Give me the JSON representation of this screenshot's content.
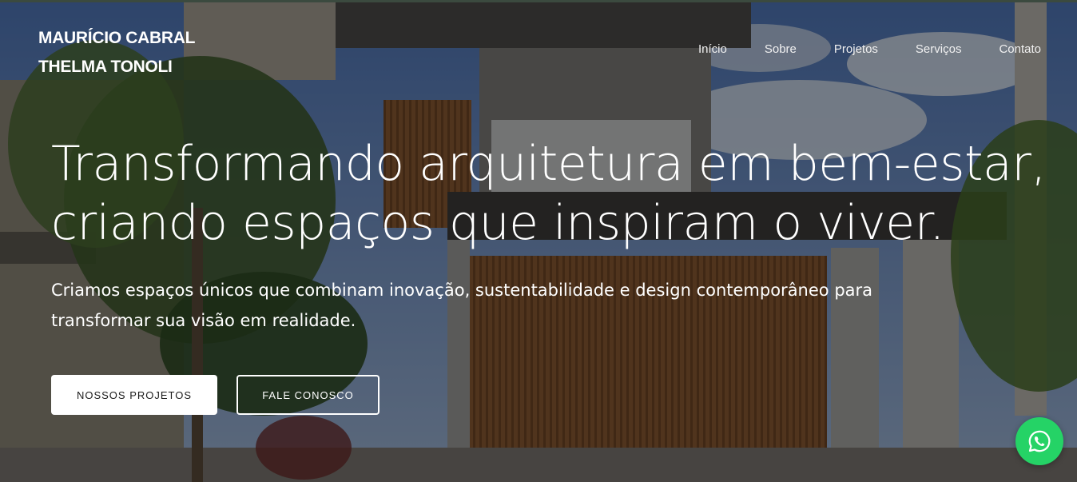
{
  "brand": {
    "line1": "MAURÍCIO CABRAL",
    "line2": "THELMA TONOLI"
  },
  "nav": {
    "items": [
      {
        "label": "Início"
      },
      {
        "label": "Sobre"
      },
      {
        "label": "Projetos"
      },
      {
        "label": "Serviços"
      },
      {
        "label": "Contato"
      }
    ]
  },
  "hero": {
    "headline_line1": "Transformando arquitetura em bem-estar,",
    "headline_line2": "criando espaços que inspiram o viver.",
    "subtitle_line1": "Criamos espaços únicos que combinam inovação, sustentabilidade e design contemporâneo para",
    "subtitle_line2": "transformar sua visão em realidade.",
    "primary_button": "NOSSOS PROJETOS",
    "secondary_button": "FALE CONOSCO"
  },
  "floating": {
    "whatsapp_icon": "whatsapp-icon"
  },
  "colors": {
    "whatsapp_green": "#25d366",
    "overlay": "#000000"
  }
}
